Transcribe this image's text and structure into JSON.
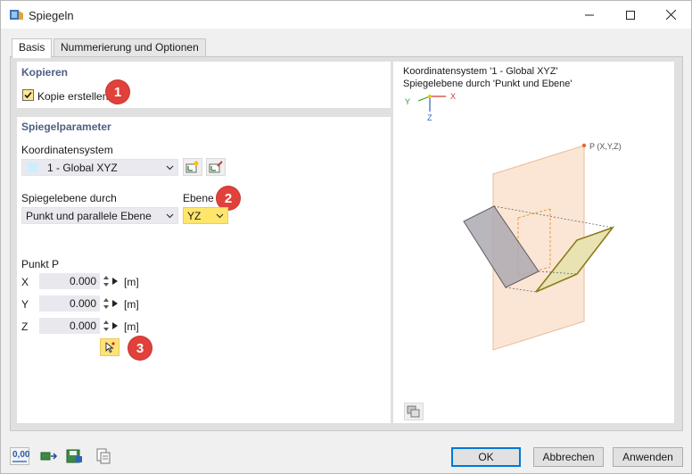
{
  "window": {
    "title": "Spiegeln"
  },
  "tabs": [
    {
      "label": "Basis",
      "active": true
    },
    {
      "label": "Nummerierung und Optionen",
      "active": false
    }
  ],
  "kopieren": {
    "title": "Kopieren",
    "checkbox_label": "Kopie erstellen",
    "checked": true,
    "badge": "1"
  },
  "spiegelparameter": {
    "title": "Spiegelparameter",
    "coord_label": "Koordinatensystem",
    "coord_value": "1 - Global XYZ",
    "plane_by_label": "Spiegelebene durch",
    "plane_by_value": "Punkt und parallele Ebene",
    "plane_label": "Ebene",
    "plane_value": "YZ",
    "badge2": "2",
    "point_label": "Punkt P",
    "point": [
      {
        "axis": "X",
        "value": "0.000",
        "unit": "[m]"
      },
      {
        "axis": "Y",
        "value": "0.000",
        "unit": "[m]"
      },
      {
        "axis": "Z",
        "value": "0.000",
        "unit": "[m]"
      }
    ],
    "badge3": "3"
  },
  "preview": {
    "line1": "Koordinatensystem '1 - Global XYZ'",
    "line2": "Spiegelebene durch 'Punkt und Ebene'",
    "axis_x": "X",
    "axis_y": "Y",
    "axis_z": "Z",
    "point_label": "P (X,Y,Z)"
  },
  "footer": {
    "ok": "OK",
    "cancel": "Abbrechen",
    "apply": "Anwenden",
    "units_icon_text": "0,00"
  },
  "colors": {
    "accent_blue": "#0078d7",
    "badge_red": "#e0413b",
    "highlight_yellow": "#ffe66b",
    "group_title": "#4d5f83"
  }
}
